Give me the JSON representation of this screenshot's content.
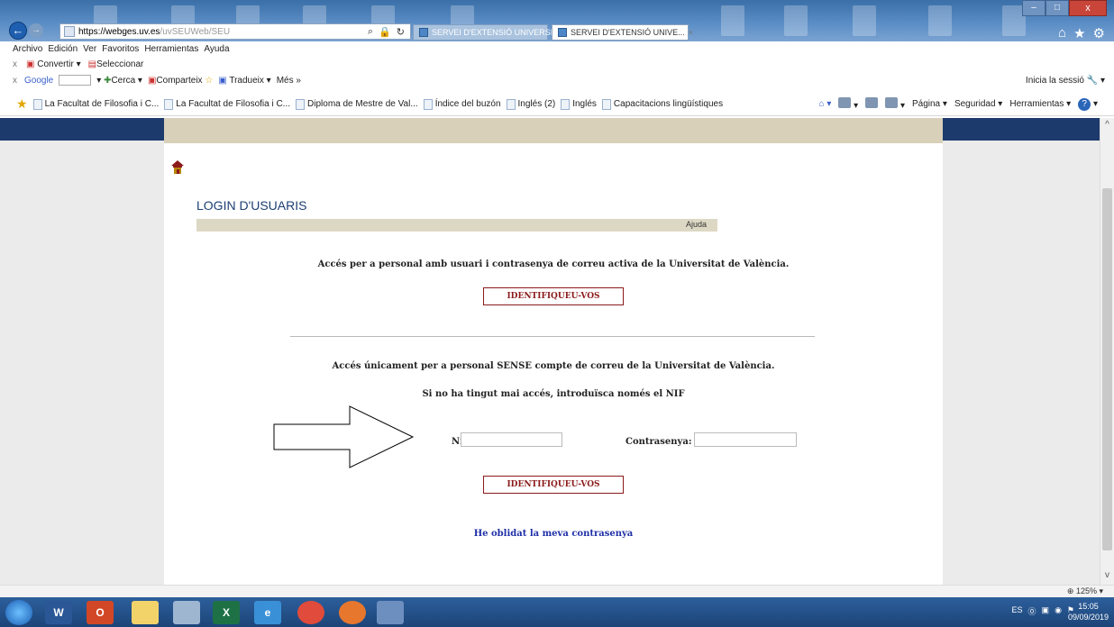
{
  "browser": {
    "url_domain": "https://webges.uv.es",
    "url_path": "/uvSEUWeb/SEU",
    "search_icon": "⌕",
    "lock_icon": "🔒",
    "refresh_icon": "↻",
    "tabs": [
      {
        "label": "SERVEI D'EXTENSIÓ UNIVERSI..."
      },
      {
        "label": "SERVEI D'EXTENSIÓ UNIVE...",
        "close": "×"
      }
    ],
    "window_controls": {
      "minimize": "‒",
      "maximize": "□",
      "close": "x"
    },
    "right_icons": {
      "home": "⌂",
      "favorites": "★",
      "settings": "⚙"
    }
  },
  "menubar": {
    "items": [
      "Archivo",
      "Edición",
      "Ver",
      "Favoritos",
      "Herramientas",
      "Ayuda"
    ]
  },
  "toolbar1": {
    "close": "x",
    "convert": "Convertir",
    "select": "Seleccionar"
  },
  "toolbar2": {
    "close": "x",
    "google": "Google",
    "search": "Cerca",
    "share": "Comparteix",
    "translate": "Tradueix",
    "more": "Més »",
    "signin": "Inicia la sessió"
  },
  "favorites": {
    "items": [
      "La Facultat de Filosofia i C...",
      "La Facultat de Filosofia i C...",
      "Diploma de Mestre de Val...",
      "Índice del buzón",
      "Inglés (2)",
      "Inglés",
      "Capacitacions lingüístiques"
    ]
  },
  "command_bar": {
    "page": "Página",
    "security": "Seguridad",
    "tools": "Herramientas",
    "help": "?"
  },
  "page": {
    "title": "LOGIN D'USUARIS",
    "help_link": "Ajuda",
    "msg_account": "Accés per a personal amb usuari i contrasenya de correu activa de la Universitat de València.",
    "btn_identify_1": "IDENTIFIQUEU-VOS",
    "msg_no_account": "Accés únicament per a personal SENSE compte de correu de la Universitat de València.",
    "msg_first_access": "Si no ha tingut mai accés, introduïsca només el NIF",
    "nif_label": "Nif:",
    "nif_value": "",
    "password_label": "Contrasenya:",
    "password_value": "",
    "btn_identify_2": "IDENTIFIQUEU-VOS",
    "forgot_link": "He oblidat la meva contrasenya"
  },
  "statusbar": {
    "zoom": "125%"
  },
  "taskbar": {
    "apps": [
      "W",
      "O",
      "",
      "",
      "X",
      "e",
      "",
      "",
      ""
    ],
    "tray_lang": "ES",
    "time": "15:05",
    "date": "09/09/2019"
  }
}
